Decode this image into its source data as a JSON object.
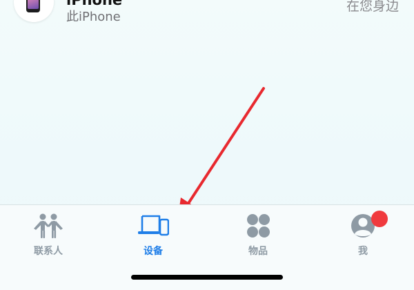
{
  "device": {
    "name": "iPhone",
    "subtitle": "此iPhone",
    "status": "在您身边",
    "thumbnail_icon": "iphone-icon"
  },
  "tabbar": {
    "active_tab": "devices",
    "active_color": "#1f7ee8",
    "inactive_color": "#8e9aa4",
    "tabs": [
      {
        "id": "people",
        "label": "联系人",
        "icon": "people-icon"
      },
      {
        "id": "devices",
        "label": "设备",
        "icon": "devices-icon"
      },
      {
        "id": "items",
        "label": "物品",
        "icon": "items-icon"
      },
      {
        "id": "me",
        "label": "我",
        "icon": "person-icon",
        "badge": true
      }
    ]
  },
  "annotation": {
    "type": "arrow",
    "color": "#e8292f",
    "points_to": "devices"
  }
}
